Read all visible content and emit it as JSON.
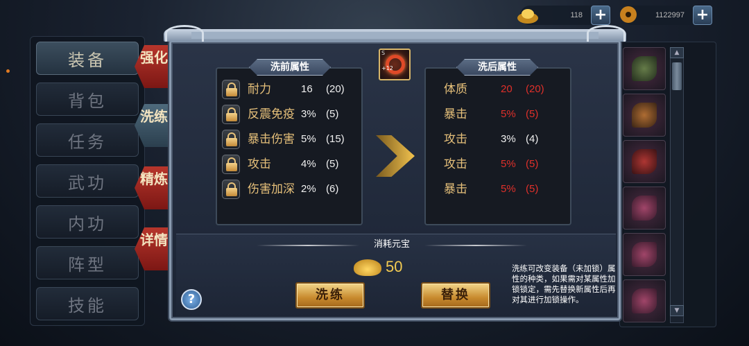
{
  "top_bar": {
    "ingot_count": "118",
    "coin_count": "1122997"
  },
  "menu": {
    "items": [
      {
        "label": "装备",
        "active": true
      },
      {
        "label": "背包",
        "active": false
      },
      {
        "label": "任务",
        "active": false
      },
      {
        "label": "武功",
        "active": false
      },
      {
        "label": "内功",
        "active": false
      },
      {
        "label": "阵型",
        "active": false
      },
      {
        "label": "技能",
        "active": false
      }
    ]
  },
  "side_tabs": [
    {
      "label": "强化"
    },
    {
      "label": "洗练"
    },
    {
      "label": "精炼"
    },
    {
      "label": "详情"
    }
  ],
  "equipment": {
    "rarity": "S",
    "level": "+12"
  },
  "before_panel": {
    "title": "洗前属性",
    "rows": [
      {
        "name": "耐力",
        "value": "16",
        "max": "(20)"
      },
      {
        "name": "反震免疫",
        "value": "3%",
        "max": "(5)"
      },
      {
        "name": "暴击伤害",
        "value": "5%",
        "max": "(15)"
      },
      {
        "name": "攻击",
        "value": "4%",
        "max": "(5)"
      },
      {
        "name": "伤害加深",
        "value": "2%",
        "max": "(6)"
      }
    ]
  },
  "after_panel": {
    "title": "洗后属性",
    "rows": [
      {
        "name": "体质",
        "value": "20",
        "max": "(20)",
        "maxed": true
      },
      {
        "name": "暴击",
        "value": "5%",
        "max": "(5)",
        "maxed": true
      },
      {
        "name": "攻击",
        "value": "3%",
        "max": "(4)",
        "maxed": false
      },
      {
        "name": "攻击",
        "value": "5%",
        "max": "(5)",
        "maxed": true
      },
      {
        "name": "暴击",
        "value": "5%",
        "max": "(5)",
        "maxed": true
      }
    ]
  },
  "cost": {
    "label": "消耗元宝",
    "amount": "50"
  },
  "buttons": {
    "wash": "洗练",
    "replace": "替换",
    "help": "?"
  },
  "description": "洗练可改变装备（未加锁）属性的种类，如果需对某属性加锁锁定，需先替换新属性后再对其进行加锁操作。",
  "colors": {
    "attr_name": "#e6c07a",
    "maxed_value": "#e0302a",
    "gold_button": "#c88a2e"
  }
}
